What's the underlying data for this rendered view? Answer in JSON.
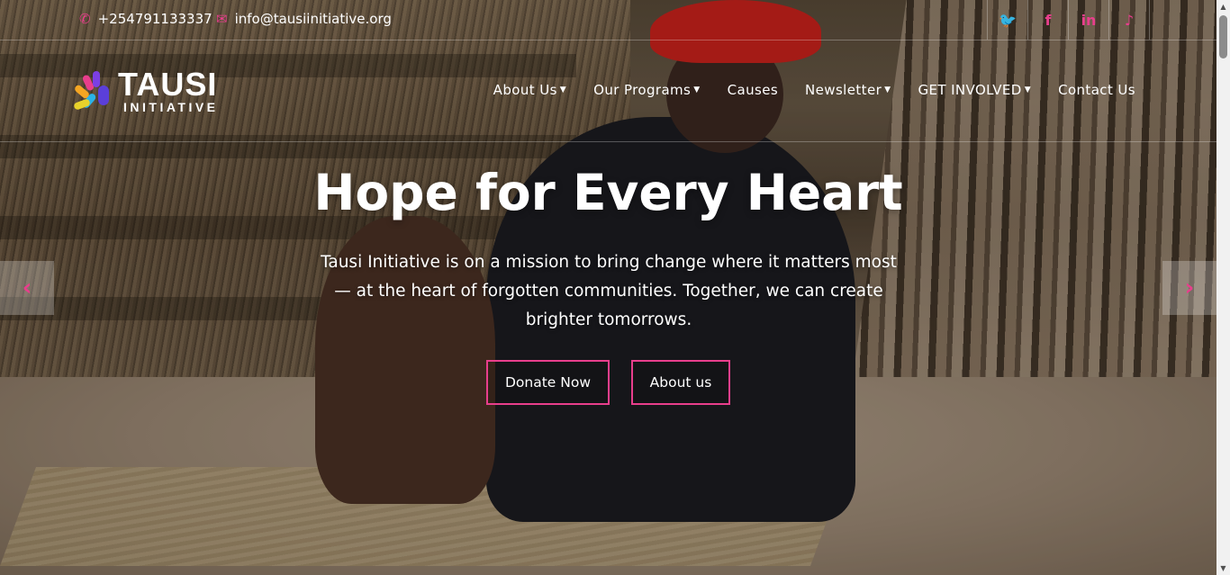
{
  "topbar": {
    "phone": "+254791133337",
    "email": "info@tausiinitiative.org",
    "social": [
      {
        "name": "twitter-icon",
        "glyph": "🐦"
      },
      {
        "name": "facebook-icon",
        "glyph": "f"
      },
      {
        "name": "linkedin-icon",
        "glyph": "in"
      },
      {
        "name": "tiktok-icon",
        "glyph": "♪"
      }
    ]
  },
  "logo": {
    "title": "TAUSI",
    "subtitle": "INITIATIVE"
  },
  "nav": {
    "items": [
      {
        "label": "About Us",
        "dropdown": true
      },
      {
        "label": "Our Programs",
        "dropdown": true
      },
      {
        "label": "Causes",
        "dropdown": false
      },
      {
        "label": "Newsletter",
        "dropdown": true
      },
      {
        "label": "GET INVOLVED",
        "dropdown": true
      },
      {
        "label": "Contact Us",
        "dropdown": false
      }
    ]
  },
  "hero": {
    "title": "Hope for Every Heart",
    "text": "Tausi Initiative is on a mission to bring change where it matters most — at the heart of forgotten communities. Together, we can create brighter tomorrows.",
    "primary_button": "Donate Now",
    "secondary_button": "About us"
  },
  "colors": {
    "accent": "#e83e8c"
  }
}
